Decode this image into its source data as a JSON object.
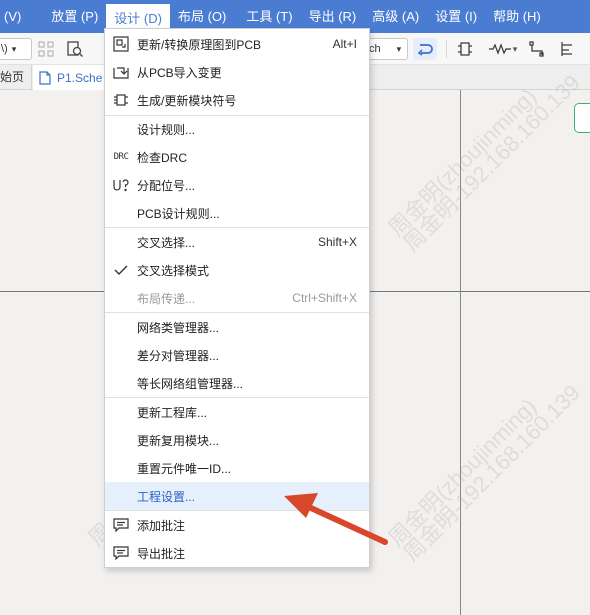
{
  "menubar": {
    "items": [
      {
        "label": "(V)"
      },
      {
        "label": "放置 (P)"
      },
      {
        "label": "设计 (D)"
      },
      {
        "label": "布局 (O)"
      },
      {
        "label": "工具 (T)"
      },
      {
        "label": "导出 (R)"
      },
      {
        "label": "高级 (A)"
      },
      {
        "label": "设置 (I)"
      },
      {
        "label": "帮助 (H)"
      }
    ]
  },
  "toolbar": {
    "left_select_value": "\\)",
    "unit_select_value": "ch"
  },
  "tabs": {
    "home_label": "始页",
    "doc_label": "P1.Sche"
  },
  "design_menu": {
    "items": [
      {
        "label": "更新/转换原理图到PCB",
        "shortcut": "Alt+I",
        "icon": "update-pcb-icon"
      },
      {
        "label": "从PCB导入变更",
        "icon": "import-changes-icon"
      },
      {
        "label": "生成/更新模块符号",
        "icon": "module-symbol-icon"
      },
      {
        "label": "设计规则..."
      },
      {
        "label": "检查DRC",
        "icon_text": "DRC"
      },
      {
        "label": "分配位号...",
        "icon": "assign-designator-icon"
      },
      {
        "label": "PCB设计规则..."
      },
      {
        "label": "交叉选择...",
        "shortcut": "Shift+X"
      },
      {
        "label": "交叉选择模式",
        "icon": "checkmark-icon"
      },
      {
        "label": "布局传递...",
        "shortcut": "Ctrl+Shift+X"
      },
      {
        "label": "网络类管理器..."
      },
      {
        "label": "差分对管理器..."
      },
      {
        "label": "等长网络组管理器..."
      },
      {
        "label": "更新工程库..."
      },
      {
        "label": "更新复用模块..."
      },
      {
        "label": "重置元件唯一ID..."
      },
      {
        "label": "工程设置..."
      },
      {
        "label": "添加批注",
        "icon": "add-comment-icon"
      },
      {
        "label": "导出批注",
        "icon": "export-comment-icon"
      }
    ]
  },
  "watermark": {
    "line1": "周金明(zhoujinming)",
    "line2": "周金明-192.168.160.139"
  },
  "colors": {
    "menubar_bg": "#4a7cd2",
    "highlight_bg": "#e6f0fc",
    "arrow": "#d9472b"
  }
}
